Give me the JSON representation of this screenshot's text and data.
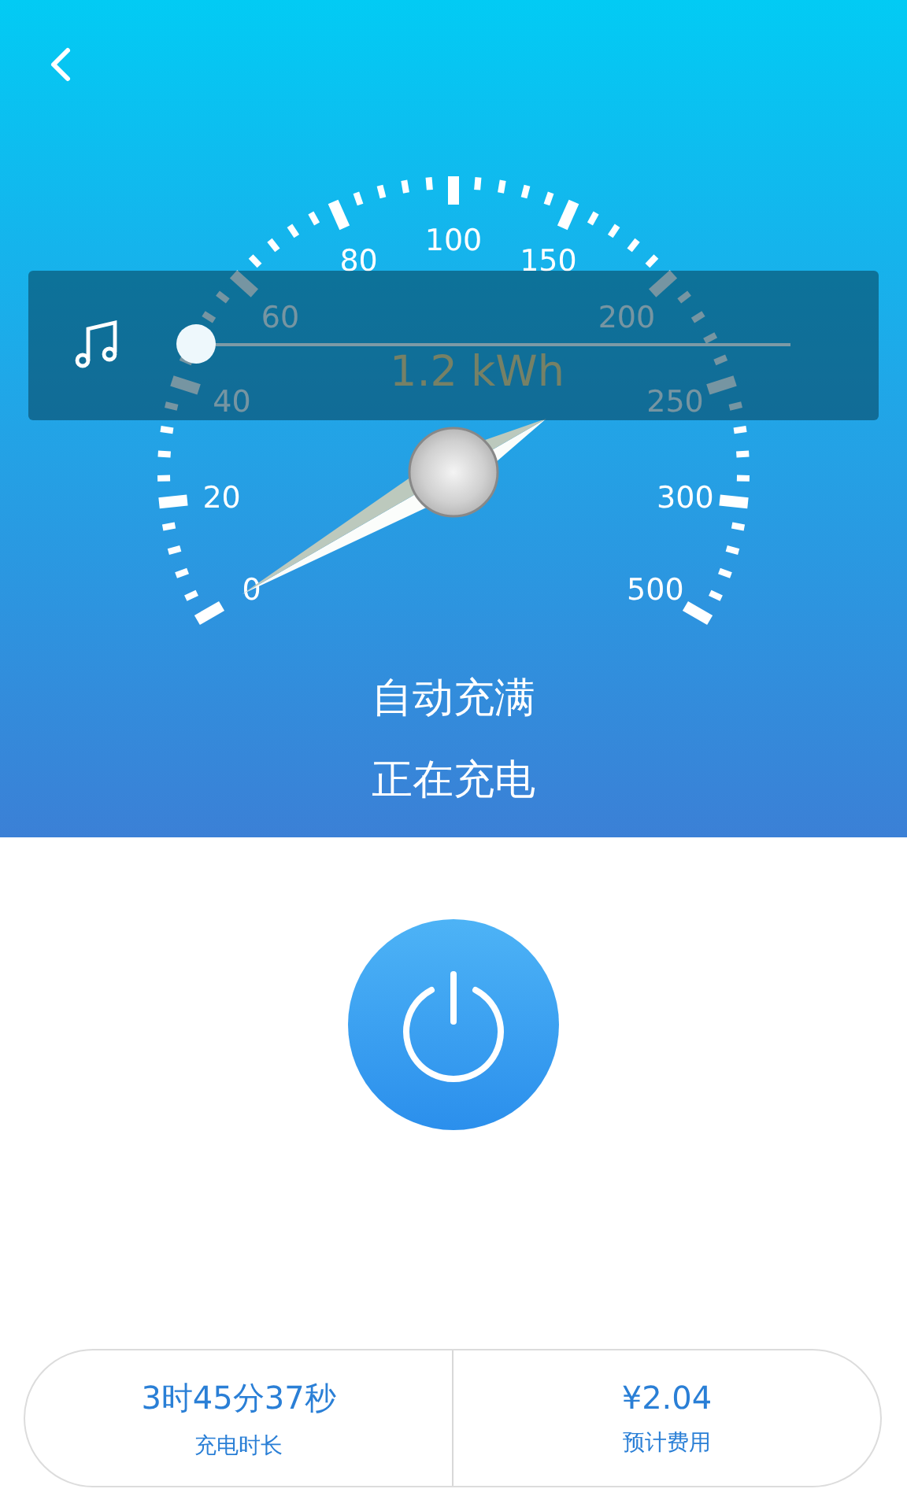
{
  "gauge": {
    "labels": [
      "0",
      "20",
      "40",
      "60",
      "80",
      "100",
      "150",
      "200",
      "250",
      "300",
      "500"
    ],
    "reading": "1.2 kWh"
  },
  "status": [
    "自动充满",
    "正在充电"
  ],
  "volume_overlay": {
    "level": 0
  },
  "stats": [
    {
      "value": "3时45分37秒",
      "label": "充电时长"
    },
    {
      "value": "¥2.04",
      "label": "预计费用"
    }
  ]
}
